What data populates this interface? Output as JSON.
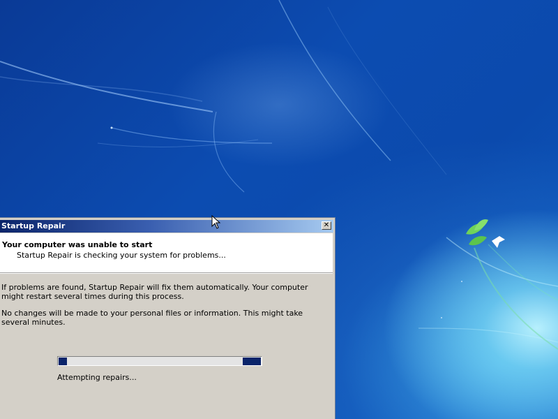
{
  "window": {
    "title": "Startup Repair",
    "close_glyph": "✕",
    "header": {
      "title": "Your computer was unable to start",
      "subtitle": "Startup Repair is checking your system for problems..."
    },
    "body": {
      "paragraph_1": "If problems are found, Startup Repair will fix them automatically. Your computer might restart several times during this process.",
      "paragraph_2": "No changes will be made to your personal files or information. This might take several minutes."
    },
    "progress": {
      "state": "marquee",
      "status_text": "Attempting repairs..."
    }
  },
  "colors": {
    "titlebar_start": "#0a246a",
    "titlebar_end": "#a6caf0",
    "dialog_face": "#d4d0c8",
    "progress_fill": "#0a246a",
    "desktop_blue": "#0c4cb1"
  },
  "icons": {
    "close": "close-icon",
    "cursor": "arrow-cursor-icon",
    "wallpaper_logo": "bird-and-leaves-icon"
  }
}
